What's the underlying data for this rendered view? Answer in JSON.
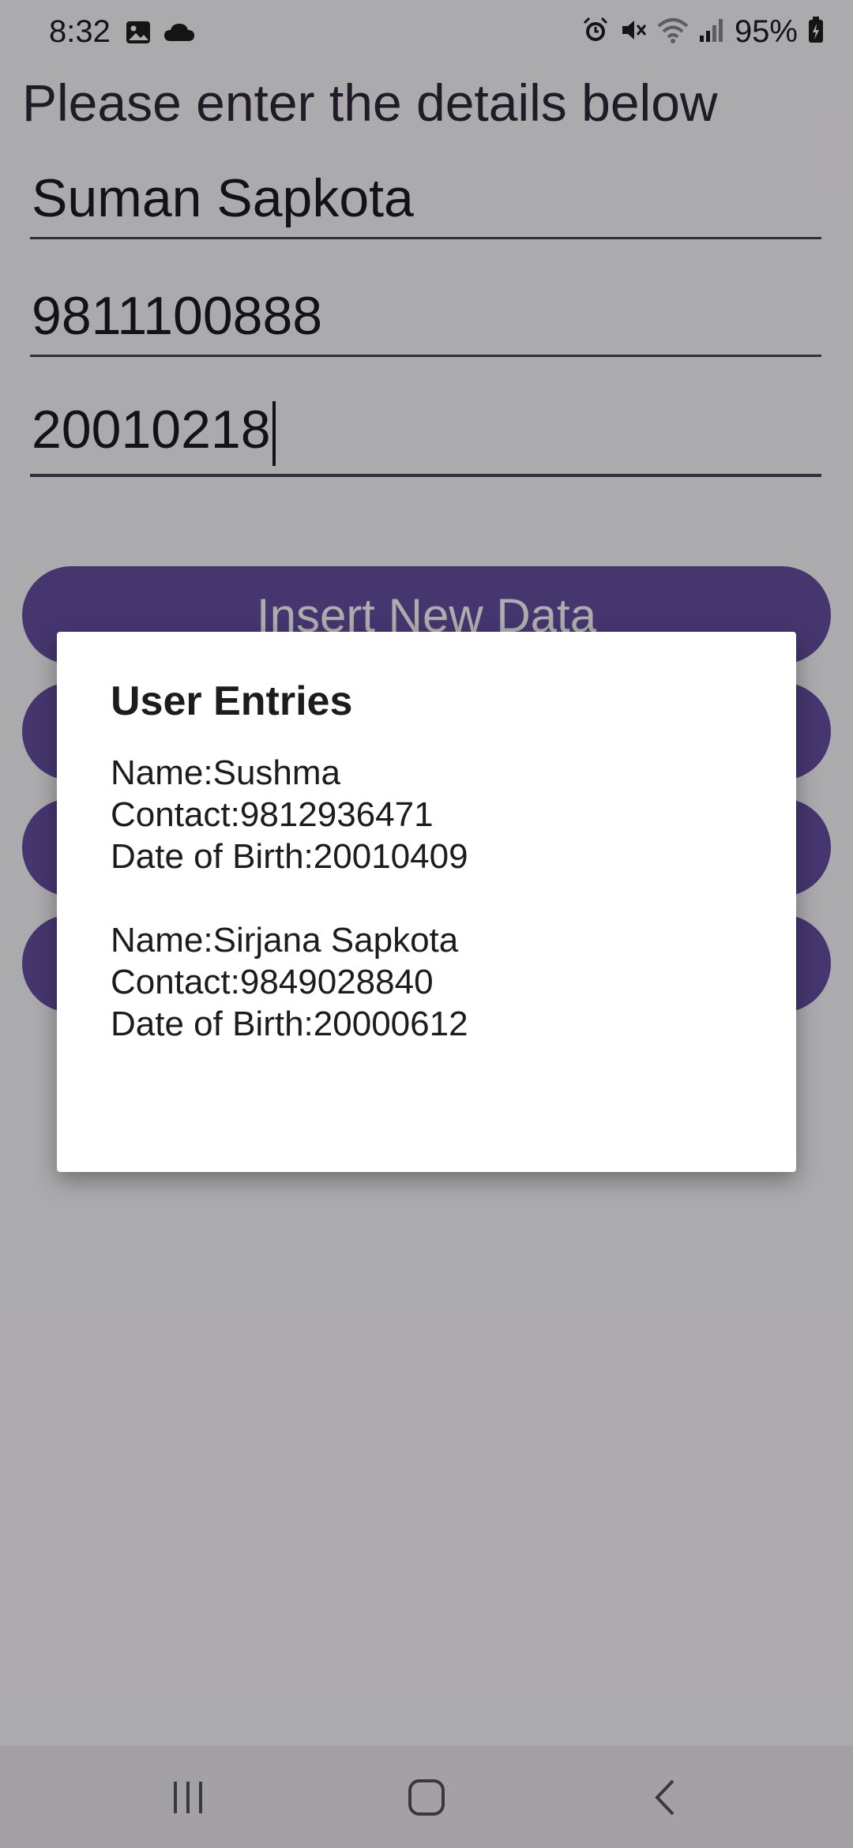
{
  "status_bar": {
    "time": "8:32",
    "battery": "95%",
    "left_icons": [
      "gallery-icon",
      "cloud-icon"
    ],
    "right_icons": [
      "alarm-icon",
      "mute-icon",
      "wifi-icon",
      "signal-icon",
      "battery-charging-icon"
    ]
  },
  "form": {
    "heading": "Please enter the details below",
    "name_value": "Suman Sapkota",
    "contact_value": "9811100888",
    "dob_value": "20010218"
  },
  "buttons": {
    "insert_label": "Insert New Data",
    "button2_label": "",
    "button3_label": "",
    "button4_label": ""
  },
  "dialog": {
    "title": "User Entries",
    "entries": [
      {
        "name": "Name:Sushma",
        "contact": "Contact:9812936471",
        "dob": "Date of Birth:20010409"
      },
      {
        "name": "Name:Sirjana Sapkota",
        "contact": "Contact:9849028840",
        "dob": "Date of Birth:20000612"
      }
    ]
  },
  "nav_bar": {
    "icons": [
      "recents-icon",
      "home-icon",
      "back-icon"
    ]
  },
  "colors": {
    "primary": "#6750a4",
    "scrim": "rgba(0,0,0,0.32)",
    "dialog_bg": "#ffffff"
  }
}
